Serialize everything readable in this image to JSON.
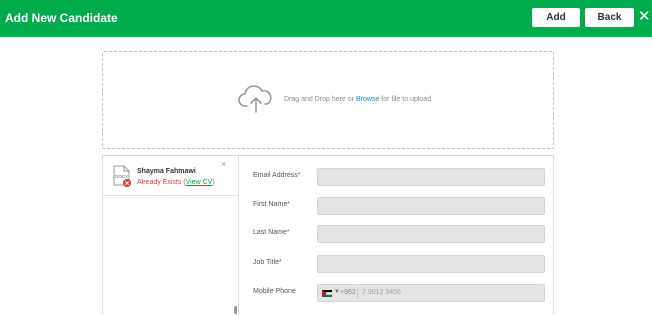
{
  "header": {
    "title": "Add New Candidate",
    "add_label": "Add",
    "back_label": "Back",
    "close_glyph": "✕",
    "bg_color": "#00ab4e"
  },
  "dropzone": {
    "icon": "cloud-upload-icon",
    "text_before": "Drag and Drop here or ",
    "browse_label": "Browse",
    "text_after": " for file to upload"
  },
  "candidate": {
    "icon": "docx-file-error-icon",
    "file_type": "DOCX",
    "name": "Shayma Fahmawi",
    "status": "Already Exists (",
    "view_cv": "View CV",
    "status_close": ")",
    "remove_glyph": "×"
  },
  "form": {
    "email_label": "Email Address",
    "first_name_label": "First Name",
    "last_name_label": "Last Name",
    "job_title_label": "Job Title",
    "mobile_label": "Mobile Phone",
    "required_mark": "*",
    "email_value": "",
    "first_name_value": "",
    "last_name_value": "",
    "job_title_value": "",
    "dial_code": "+962",
    "phone_placeholder": "7 9012 3456",
    "caret": "▼"
  }
}
